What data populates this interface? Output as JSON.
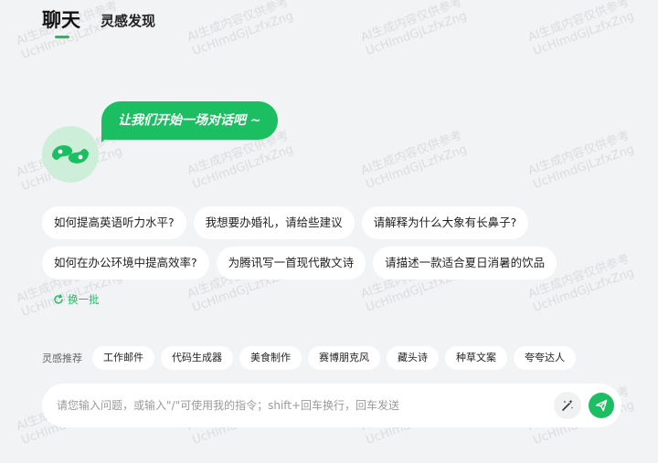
{
  "tabs": {
    "active": "聊天",
    "other": "灵感发现"
  },
  "watermark": {
    "line1": "AI生成内容仅供参考",
    "line2": "UcHlmdGjLzfxZng"
  },
  "greeting": "让我们开始一场对话吧 ~",
  "suggestions": [
    "如何提高英语听力水平?",
    "我想要办婚礼，请给些建议",
    "请解释为什么大象有长鼻子?",
    "如何在办公环境中提高效率?",
    "为腾讯写一首现代散文诗",
    "请描述一款适合夏日消暑的饮品"
  ],
  "refresh_label": "换一批",
  "inspiration": {
    "label": "灵感推荐",
    "tags": [
      "工作邮件",
      "代码生成器",
      "美食制作",
      "赛博朋克风",
      "藏头诗",
      "种草文案",
      "夸夸达人"
    ]
  },
  "input": {
    "value": "",
    "placeholder": "请您输入问题，或输入\"/\"可使用我的指令；shift+回车换行，回车发送"
  },
  "colors": {
    "accent": "#1bbf62",
    "background": "#f2f3f5",
    "avatar_bg": "#cdeed9"
  }
}
